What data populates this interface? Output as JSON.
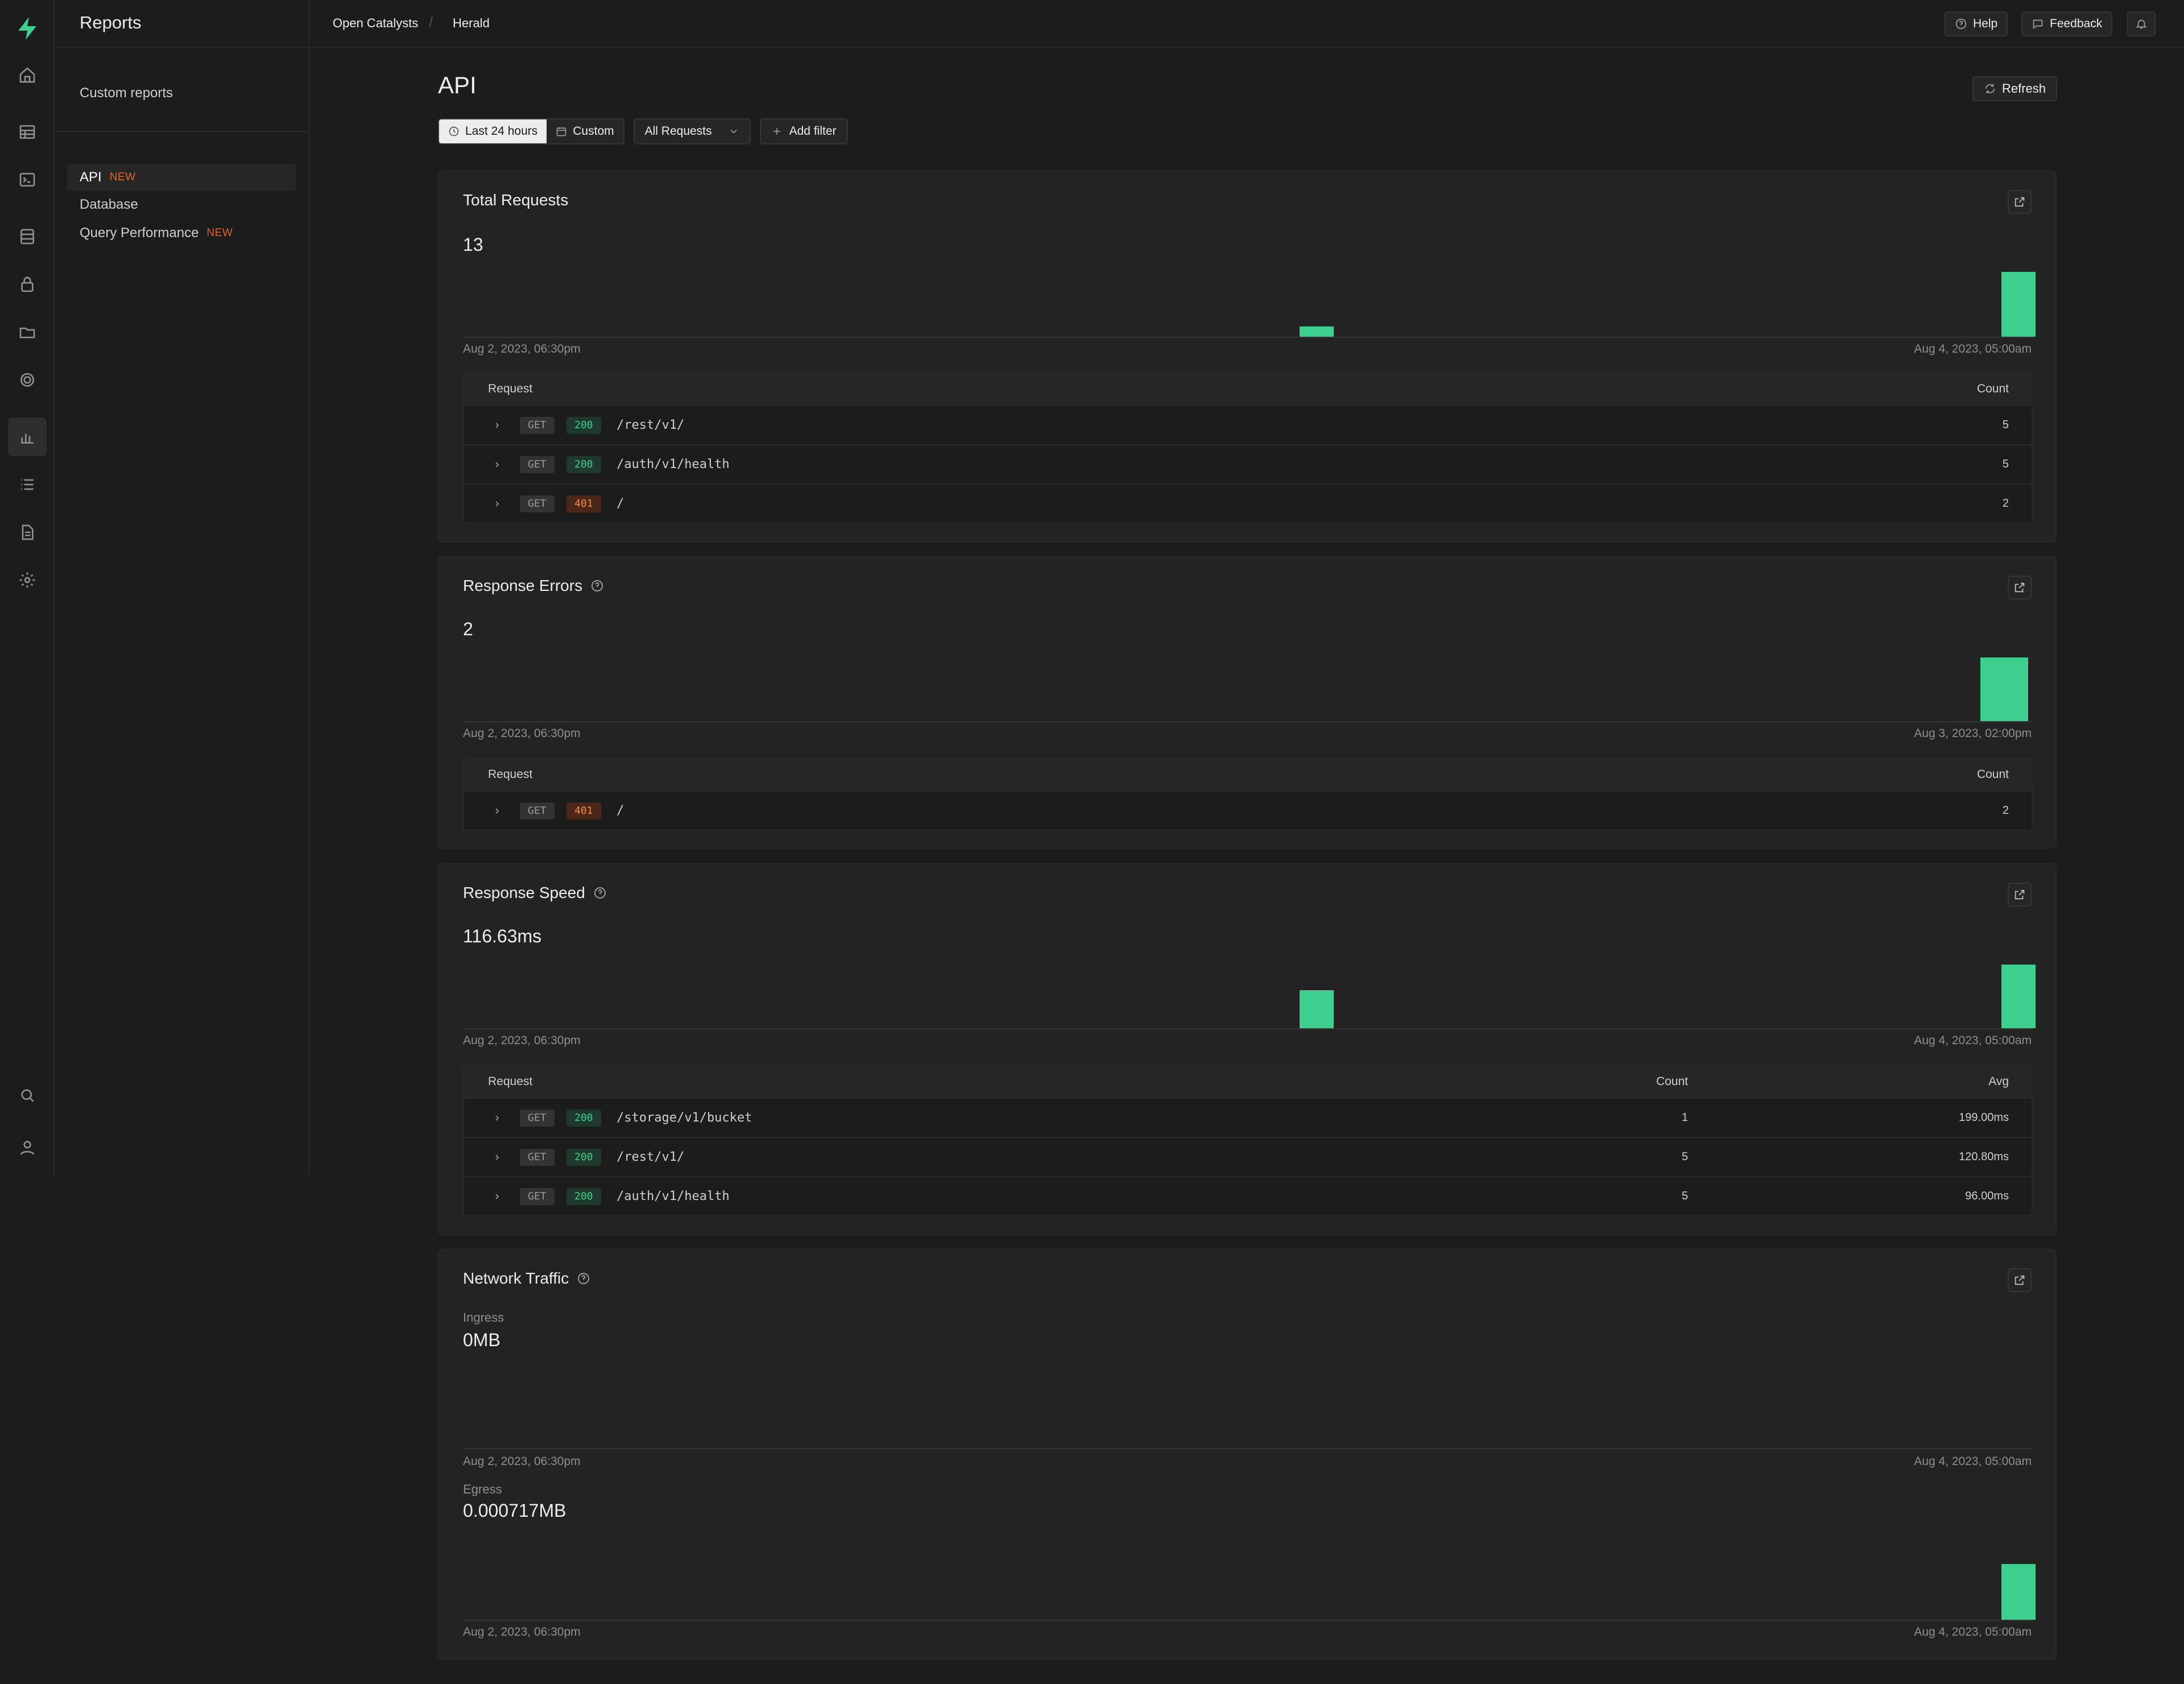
{
  "app": {
    "section_title": "Reports"
  },
  "breadcrumb": {
    "org": "Open Catalysts",
    "project": "Herald"
  },
  "topbar": {
    "help": "Help",
    "feedback": "Feedback"
  },
  "sidebar": {
    "custom_reports": "Custom reports",
    "items": [
      {
        "label": "API",
        "badge": "NEW",
        "active": true
      },
      {
        "label": "Database",
        "badge": ""
      },
      {
        "label": "Query Performance",
        "badge": "NEW"
      }
    ]
  },
  "rail_icons": [
    "home-icon",
    "table-editor-icon",
    "sql-editor-icon",
    "database-icon",
    "auth-icon",
    "storage-icon",
    "realtime-icon",
    "reports-icon",
    "logs-icon",
    "api-docs-icon",
    "settings-icon",
    "search-icon",
    "account-icon"
  ],
  "page": {
    "title": "API",
    "refresh": "Refresh"
  },
  "filters": {
    "range_last24": "Last 24 hours",
    "range_custom": "Custom",
    "requests_select": "All Requests",
    "add_filter": "Add filter"
  },
  "colors": {
    "accent": "#3ecf8e",
    "badge": "#e0652b",
    "status_ok": "#3ecf8e",
    "status_err": "#f0884d"
  },
  "cards": {
    "total_requests": {
      "title": "Total Requests",
      "value": "13",
      "axis_start": "Aug 2, 2023, 06:30pm",
      "axis_end": "Aug 4, 2023, 05:00am",
      "table_headers": [
        "Request",
        "Count"
      ],
      "rows": [
        {
          "method": "GET",
          "status": "200",
          "path": "/rest/v1/",
          "count": "5"
        },
        {
          "method": "GET",
          "status": "200",
          "path": "/auth/v1/health",
          "count": "5"
        },
        {
          "method": "GET",
          "status": "401",
          "path": "/",
          "count": "2"
        }
      ]
    },
    "response_errors": {
      "title": "Response Errors",
      "value": "2",
      "axis_start": "Aug 2, 2023, 06:30pm",
      "axis_end": "Aug 3, 2023, 02:00pm",
      "table_headers": [
        "Request",
        "Count"
      ],
      "rows": [
        {
          "method": "GET",
          "status": "401",
          "path": "/",
          "count": "2"
        }
      ]
    },
    "response_speed": {
      "title": "Response Speed",
      "value": "116.63ms",
      "axis_start": "Aug 2, 2023, 06:30pm",
      "axis_end": "Aug 4, 2023, 05:00am",
      "table_headers": [
        "Request",
        "Count",
        "Avg"
      ],
      "rows": [
        {
          "method": "GET",
          "status": "200",
          "path": "/storage/v1/bucket",
          "count": "1",
          "avg": "199.00ms"
        },
        {
          "method": "GET",
          "status": "200",
          "path": "/rest/v1/",
          "count": "5",
          "avg": "120.80ms"
        },
        {
          "method": "GET",
          "status": "200",
          "path": "/auth/v1/health",
          "count": "5",
          "avg": "96.00ms"
        }
      ]
    },
    "network_traffic": {
      "title": "Network Traffic",
      "ingress_label": "Ingress",
      "ingress_value": "0MB",
      "ingress_axis_start": "Aug 2, 2023, 06:30pm",
      "ingress_axis_end": "Aug 4, 2023, 05:00am",
      "egress_label": "Egress",
      "egress_value": "0.000717MB",
      "egress_axis_start": "Aug 2, 2023, 06:30pm",
      "egress_axis_end": "Aug 4, 2023, 05:00am"
    }
  },
  "chart_data": [
    {
      "type": "bar",
      "title": "Total Requests",
      "x_range": [
        "Aug 2, 2023, 06:30pm",
        "Aug 4, 2023, 05:00am"
      ],
      "series": [
        {
          "values": [
            {
              "x": "Aug 3, 2023, ~11:00am",
              "y": 1
            },
            {
              "x": "Aug 4, 2023, 05:00am",
              "y": 12
            }
          ]
        }
      ]
    },
    {
      "type": "bar",
      "title": "Response Errors",
      "x_range": [
        "Aug 2, 2023, 06:30pm",
        "Aug 3, 2023, 02:00pm"
      ],
      "series": [
        {
          "values": [
            {
              "x": "Aug 3, 2023, 02:00pm",
              "y": 2
            }
          ]
        }
      ]
    },
    {
      "type": "bar",
      "title": "Response Speed",
      "x_range": [
        "Aug 2, 2023, 06:30pm",
        "Aug 4, 2023, 05:00am"
      ],
      "series": [
        {
          "values": [
            {
              "x": "Aug 3, 2023, ~11:00am",
              "y": 199
            },
            {
              "x": "Aug 4, 2023, 05:00am",
              "y": 333
            }
          ]
        }
      ]
    },
    {
      "type": "bar",
      "title": "Ingress",
      "x_range": [
        "Aug 2, 2023, 06:30pm",
        "Aug 4, 2023, 05:00am"
      ],
      "series": [
        {
          "values": []
        }
      ]
    },
    {
      "type": "bar",
      "title": "Egress",
      "x_range": [
        "Aug 2, 2023, 06:30pm",
        "Aug 4, 2023, 05:00am"
      ],
      "series": [
        {
          "values": [
            {
              "x": "Aug 4, 2023, 05:00am",
              "y": 0.000717
            }
          ]
        }
      ]
    }
  ]
}
